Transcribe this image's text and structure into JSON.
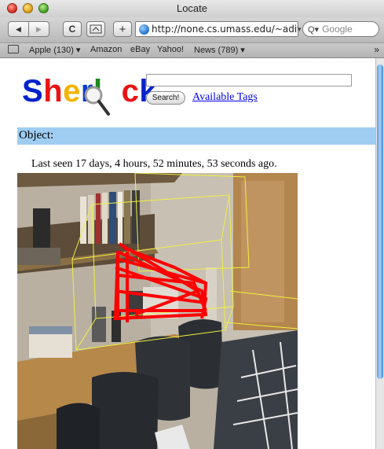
{
  "window": {
    "title": "Locate"
  },
  "toolbar": {
    "back_glyph": "◀",
    "forward_glyph": "▶",
    "reload_glyph": "C",
    "plus_glyph": "+",
    "url": "http://none.cs.umass.edu/~adityai",
    "search_placeholder": "Google",
    "search_glyph": "Q▾"
  },
  "bookmarks": [
    {
      "label": "Apple (130) ▾"
    },
    {
      "label": "Amazon"
    },
    {
      "label": "eBay"
    },
    {
      "label": "Yahoo!"
    },
    {
      "label": "News (789) ▾"
    }
  ],
  "bookmarks_more": "»",
  "page": {
    "logo": {
      "s": "S",
      "h": "h",
      "e": "e",
      "r": "r",
      "l": "l",
      "c": "c",
      "k": "k"
    },
    "search_button": "Search!",
    "tags_link": "Available Tags",
    "object_label": "Object:",
    "last_seen": "Last seen 17 days, 4 hours, 52 minutes, 53 seconds ago."
  },
  "colors": {
    "object_bar": "#9fcdf2",
    "link": "#0000ee",
    "box_wireframe": "#f0f040",
    "tracked_object": "#ff0000"
  },
  "icons": {
    "traffic_lights": [
      "close-icon",
      "minimize-icon",
      "zoom-icon"
    ],
    "bookmarks_book": "book-icon",
    "url_globe": "globe-icon",
    "logo_magnifier": "magnifier-icon"
  }
}
